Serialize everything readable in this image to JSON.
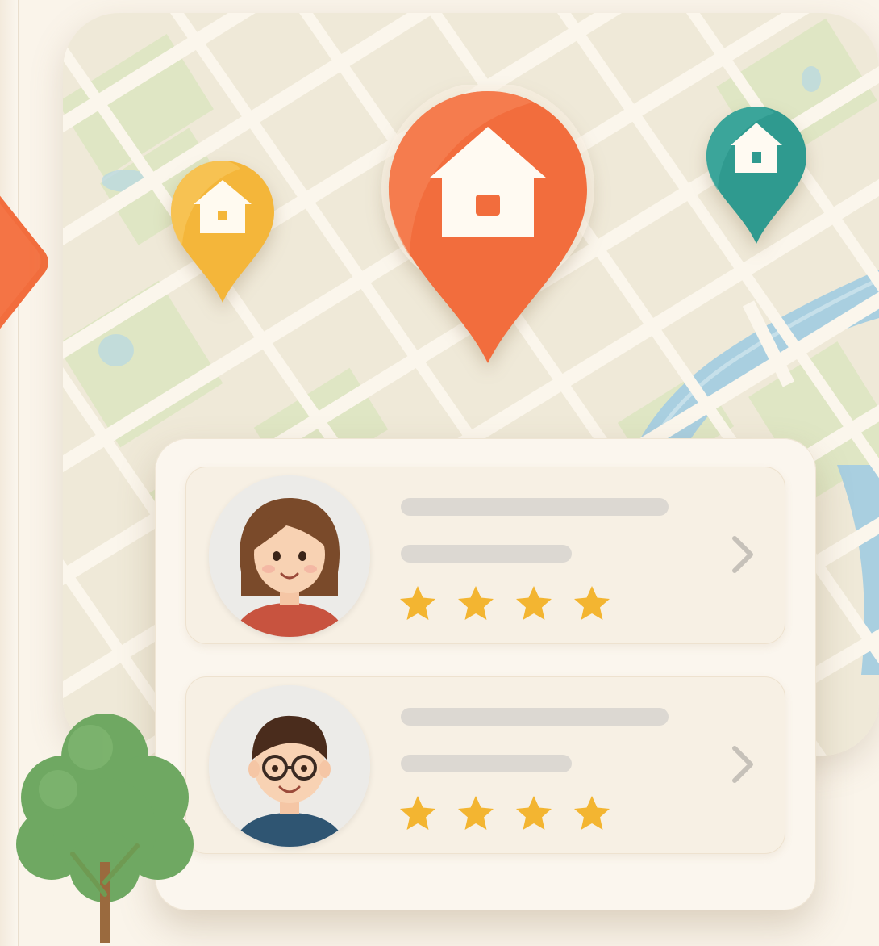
{
  "map": {
    "pins": [
      {
        "name": "home-pin-yellow",
        "color": "#f4b63a",
        "icon": "house-icon"
      },
      {
        "name": "home-pin-orange",
        "color": "#f26d3d",
        "icon": "house-icon",
        "selected": true
      },
      {
        "name": "home-pin-teal",
        "color": "#2f9a8f",
        "icon": "house-icon"
      }
    ],
    "colors": {
      "land": "#efe9d8",
      "park": "#dfe6c4",
      "road": "#fbf6ec",
      "river": "#a9cfe0"
    }
  },
  "reviews": [
    {
      "avatar": "woman-avatar",
      "rating": 4,
      "max_rating": 4,
      "chevron": "chevron-right-icon"
    },
    {
      "avatar": "man-with-glasses-avatar",
      "rating": 4,
      "max_rating": 4,
      "chevron": "chevron-right-icon"
    }
  ],
  "accents": {
    "star": "#f3b531",
    "nav_arrow": "#f26d3d",
    "tree": "#6fa862"
  }
}
